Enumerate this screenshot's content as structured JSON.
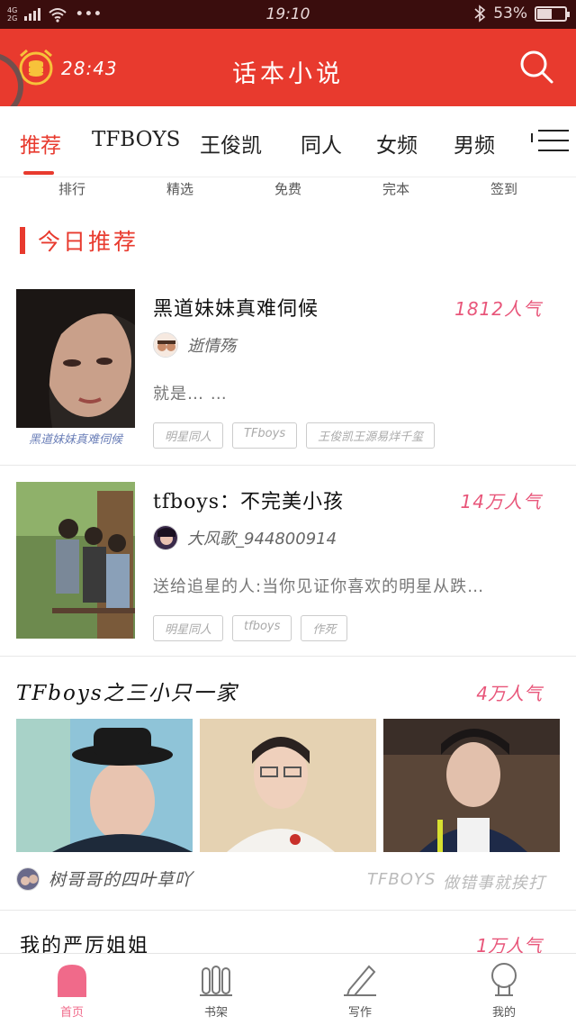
{
  "status_bar": {
    "network_top": "4G",
    "network_bottom": "2G",
    "dots": "•••",
    "time": "19:10",
    "battery": "53%",
    "battery_level": 0.53
  },
  "header": {
    "timer": "28:43",
    "title": "话本小说"
  },
  "tabs": [
    {
      "label": "推荐",
      "active": true
    },
    {
      "label": "TFBOYS"
    },
    {
      "label": "王俊凯"
    },
    {
      "label": "同人"
    },
    {
      "label": "女频"
    },
    {
      "label": "男频"
    }
  ],
  "subcats": [
    "排行",
    "精选",
    "免费",
    "完本",
    "签到"
  ],
  "section_title": "今日推荐",
  "stories": [
    {
      "title": "黑道妹妹真难伺候",
      "popularity": "1812人气",
      "author": "逝情殇",
      "desc": "就是… …",
      "tags": [
        "明星同人",
        "TFboys",
        "王俊凯王源易烊千玺"
      ],
      "cover_caption": "黑道妹妹真难伺候"
    },
    {
      "title": "tfboys：不完美小孩",
      "popularity": "14万人气",
      "author": "大风歌_944800914",
      "desc": "送给追星的人:当你见证你喜欢的明星从跌…",
      "tags": [
        "明星同人",
        "tfboys",
        "作死"
      ]
    }
  ],
  "collection": {
    "title": "TFboys之三小只一家",
    "popularity": "4万人气",
    "author": "树哥哥的四叶草吖",
    "tag1": "TFBOYS",
    "tag2": "做错事就挨打"
  },
  "last_item": {
    "title": "我的严厉姐姐",
    "popularity": "1万人气"
  },
  "bottom_nav": [
    {
      "label": "首页",
      "active": true
    },
    {
      "label": "书架"
    },
    {
      "label": "写作"
    },
    {
      "label": "我的"
    }
  ],
  "colors": {
    "brand_red": "#e83a2e",
    "popularity_pink": "#e8567a",
    "active_nav": "#f06a8a"
  }
}
